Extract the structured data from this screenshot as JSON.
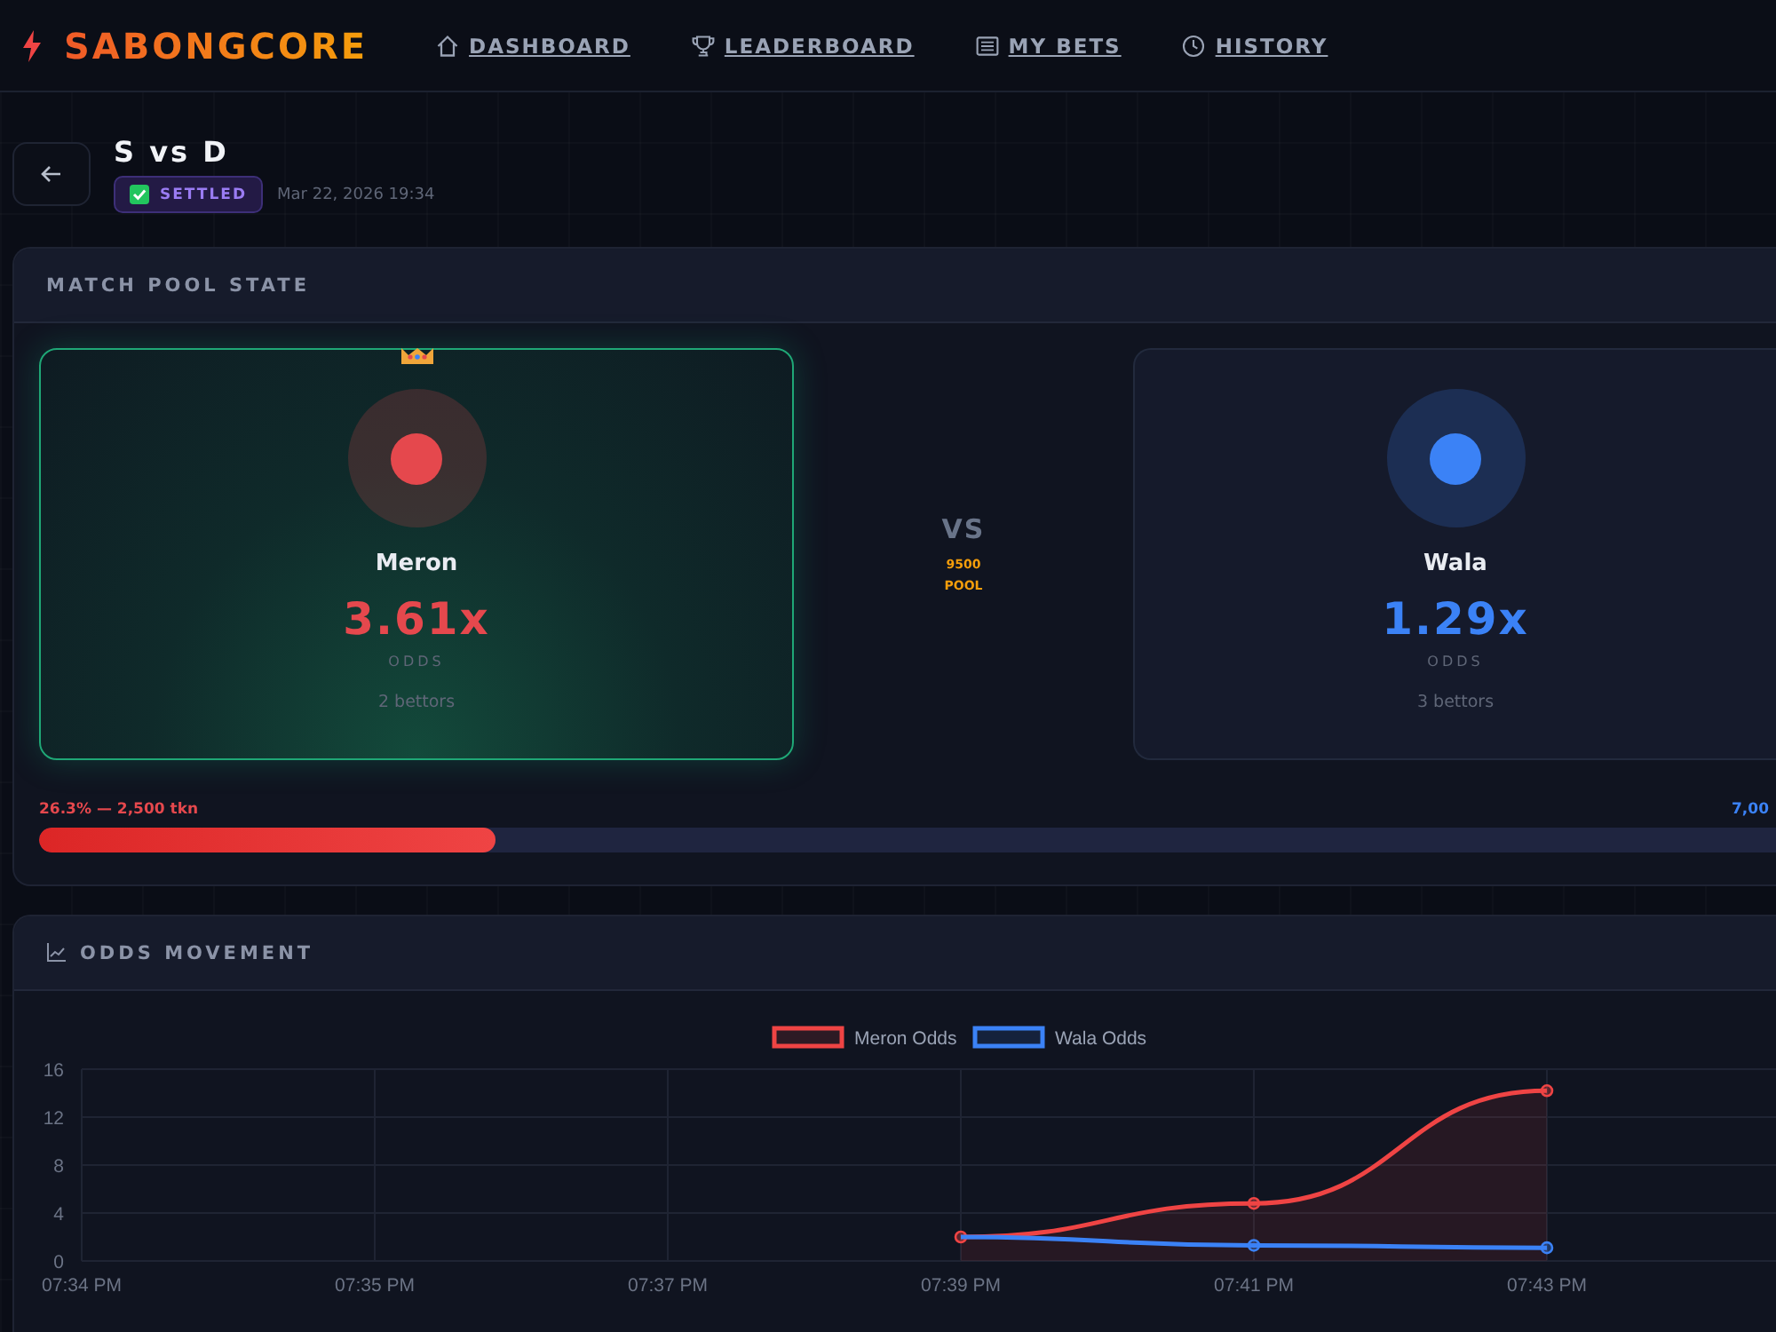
{
  "nav": {
    "brand": "SABONGCORE",
    "links": [
      {
        "label": "DASHBOARD"
      },
      {
        "label": "LEADERBOARD"
      },
      {
        "label": "MY BETS"
      },
      {
        "label": "HISTORY"
      }
    ]
  },
  "match": {
    "title": "S vs D",
    "status": "SETTLED",
    "date": "Mar 22, 2026 19:34"
  },
  "pool": {
    "title": "MATCH POOL STATE",
    "fighters": [
      {
        "name": "Meron",
        "odds": "3.61x",
        "odds_label": "ODDS",
        "bettors": "2 bettors",
        "color": "#e5484d",
        "winner": true
      },
      {
        "name": "Wala",
        "odds": "1.29x",
        "odds_label": "ODDS",
        "bettors": "3 bettors",
        "color": "#3b82f6",
        "winner": false
      }
    ],
    "vs": "VS",
    "pool_amount": "9500",
    "pool_label": "POOL",
    "left_share": "26.3% — 2,500 tkn",
    "right_share": "7,00",
    "level": 0.263
  },
  "chart": {
    "title": "ODDS MOVEMENT",
    "chart_data": {
      "type": "line",
      "categories": [
        "07:34 PM",
        "07:35 PM",
        "07:37 PM",
        "07:39 PM",
        "07:41 PM",
        "07:43 PM"
      ],
      "ylim": [
        0,
        16
      ],
      "yticks": [
        0,
        4,
        8,
        12,
        16
      ],
      "grid": true,
      "legend": "top",
      "series": [
        {
          "name": "Meron Odds",
          "color": "#ef4444",
          "marker": "circle",
          "values": [
            null,
            null,
            null,
            2,
            4.8,
            14.2
          ]
        },
        {
          "name": "Wala Odds",
          "color": "#3b82f6",
          "marker": "circle",
          "values": [
            null,
            null,
            null,
            2,
            1.3,
            1.1
          ]
        }
      ]
    }
  }
}
